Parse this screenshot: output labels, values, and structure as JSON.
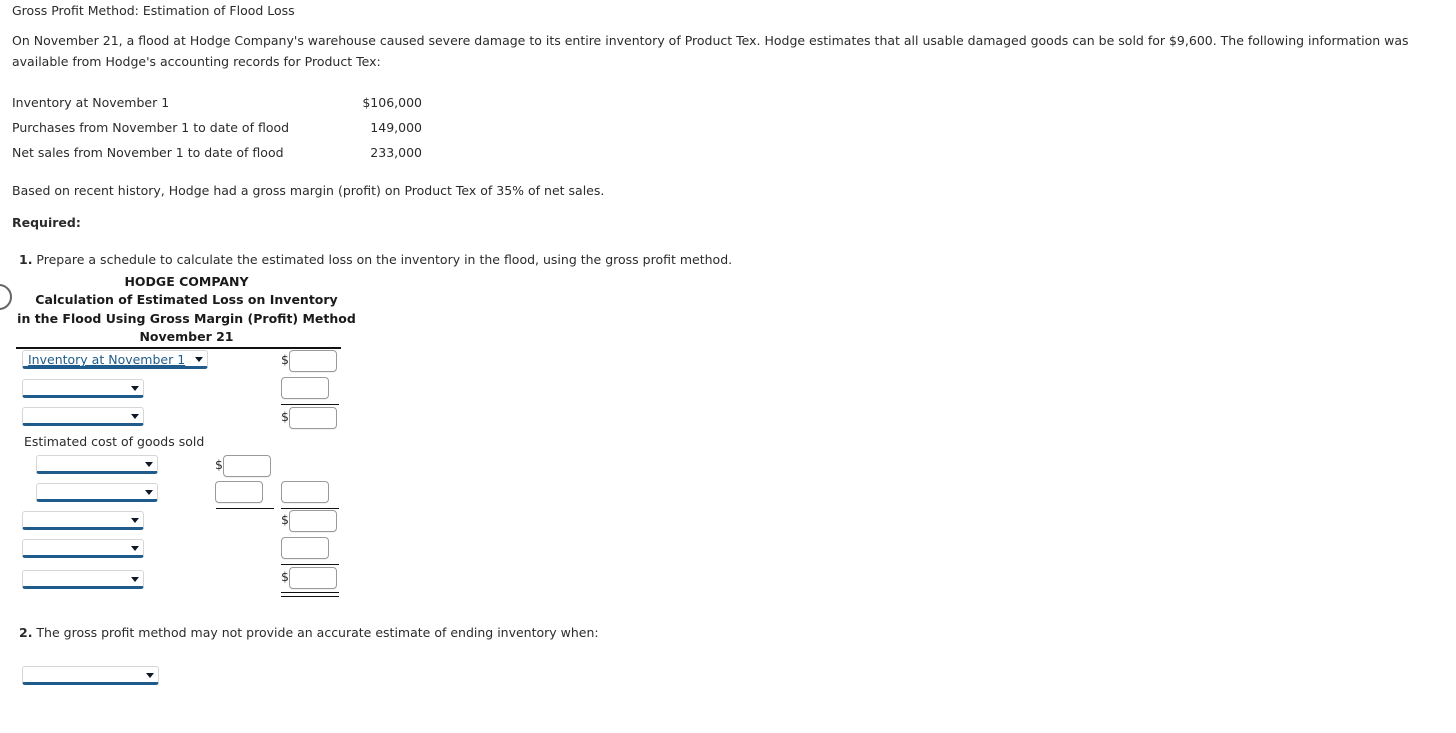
{
  "lesson": {
    "title": "Gross Profit Method: Estimation of Flood Loss"
  },
  "intro": {
    "paragraph": "On November 21, a flood at Hodge Company's warehouse caused severe damage to its entire inventory of Product Tex. Hodge estimates that all usable damaged goods can be sold for $9,600. The following information was available from Hodge's accounting records for Product Tex:"
  },
  "facts": {
    "rows": [
      {
        "label": "Inventory at November 1",
        "amount": "$106,000"
      },
      {
        "label": "Purchases from November 1 to date of flood",
        "amount": "149,000"
      },
      {
        "label": "Net sales from November 1 to date of flood",
        "amount": "233,000"
      }
    ],
    "note": "Based on recent history, Hodge had a gross margin (profit) on Product Tex of 35% of net sales."
  },
  "required": {
    "label": "Required:",
    "question1_number": "1.",
    "question1_text": " Prepare a schedule to calculate the estimated loss on the inventory in the flood, using the gross profit method.",
    "question2_number": "2.",
    "question2_text": " The gross profit method may not provide an accurate estimate of ending inventory when:"
  },
  "worksheet": {
    "title_line1": "HODGE COMPANY",
    "title_line2": "Calculation of Estimated Loss on Inventory",
    "title_line3": "in the Flood Using Gross Margin (Profit) Method",
    "title_line4": "November 21",
    "static_label_cogs": "Estimated cost of goods sold",
    "dropdown_placeholder": "",
    "row1_selected": "Inventory at November 1",
    "dollar_sign": "$",
    "input_value": ""
  },
  "answer2": {
    "dropdown_value": ""
  },
  "colors": {
    "select_accent": "#1f5c8b",
    "rule": "#111111",
    "text": "#2b2b2b",
    "input_border": "#9a9a9a"
  }
}
